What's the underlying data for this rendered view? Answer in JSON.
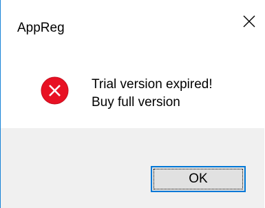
{
  "window": {
    "title": "AppReg",
    "close_icon": "close-icon"
  },
  "message": {
    "icon": "error-icon",
    "line1": "Trial version expired!",
    "line2": "Buy full version"
  },
  "buttons": {
    "ok_label": "OK"
  },
  "colors": {
    "accent": "#0078d7",
    "error_red": "#e81123",
    "footer_bg": "#f0f0f0"
  }
}
